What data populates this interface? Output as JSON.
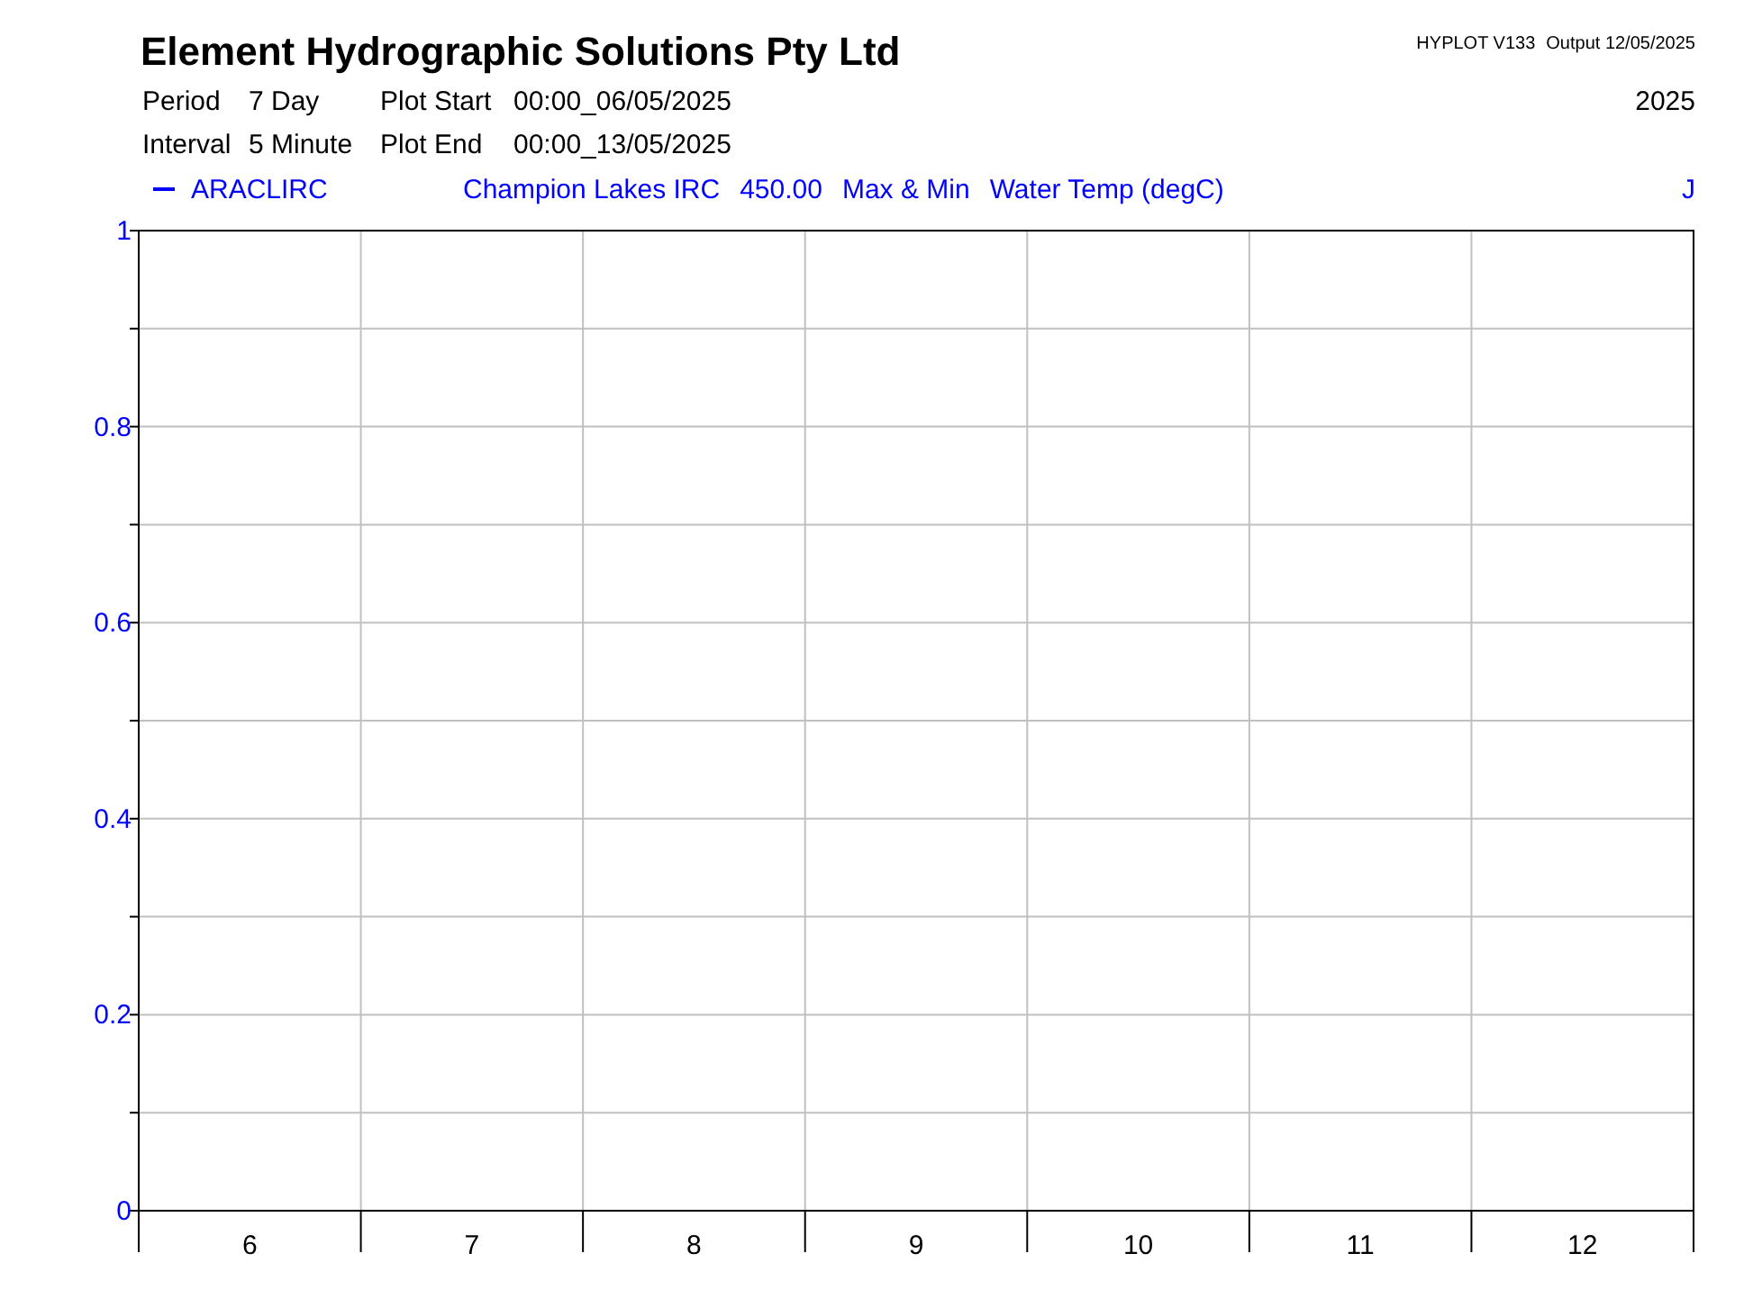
{
  "header": {
    "company": "Element Hydrographic Solutions Pty Ltd",
    "program": "HYPLOT V133",
    "output": "Output 12/05/2025",
    "year": "2025",
    "info": [
      {
        "label": "Period",
        "value": "7 Day",
        "label2": "Plot Start",
        "value2": "00:00_06/05/2025"
      },
      {
        "label": "Interval",
        "value": "5 Minute",
        "label2": "Plot End",
        "value2": "00:00_13/05/2025"
      }
    ]
  },
  "legend": {
    "series": "ARACLIRC",
    "color": "#0000ff",
    "site": "Champion Lakes IRC",
    "site_value": "450.00",
    "statistic": "Max & Min",
    "variable": "Water Temp (degC)",
    "flag": "J"
  },
  "chart_data": {
    "type": "line",
    "grid": true,
    "categories": [
      "6",
      "7",
      "8",
      "9",
      "10",
      "11",
      "12"
    ],
    "ylim": [
      0,
      1
    ],
    "yticks": [
      0,
      0.2,
      0.4,
      0.6,
      0.8,
      1
    ]
  }
}
